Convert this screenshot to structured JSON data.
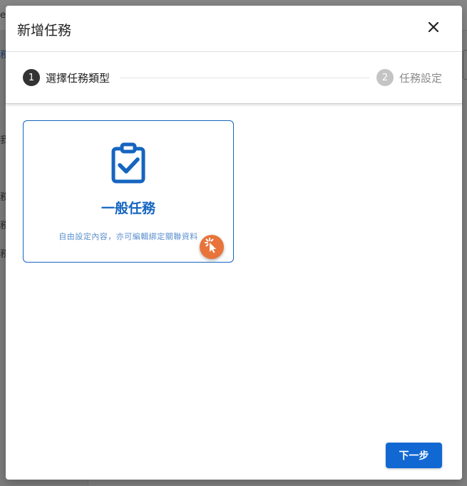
{
  "background": {
    "fragments": [
      "e",
      "務",
      "我",
      "務",
      "務",
      "務"
    ]
  },
  "dialog": {
    "title": "新增任務",
    "close_icon": "close-icon"
  },
  "stepper": {
    "steps": [
      {
        "number": "1",
        "label": "選擇任務類型",
        "state": "active"
      },
      {
        "number": "2",
        "label": "任務設定",
        "state": "inactive"
      }
    ]
  },
  "task_card": {
    "icon": "clipboard-check-icon",
    "title": "一般任務",
    "description": "自由設定內容，亦可編輯綁定關聯資料",
    "badge_icon": "click-cursor-icon"
  },
  "footer": {
    "next_label": "下一步"
  },
  "colors": {
    "primary": "#1268d3",
    "card_accent": "#1565c0",
    "badge": "#e8743b",
    "step_active": "#333333",
    "step_inactive": "#c4c4c4"
  }
}
